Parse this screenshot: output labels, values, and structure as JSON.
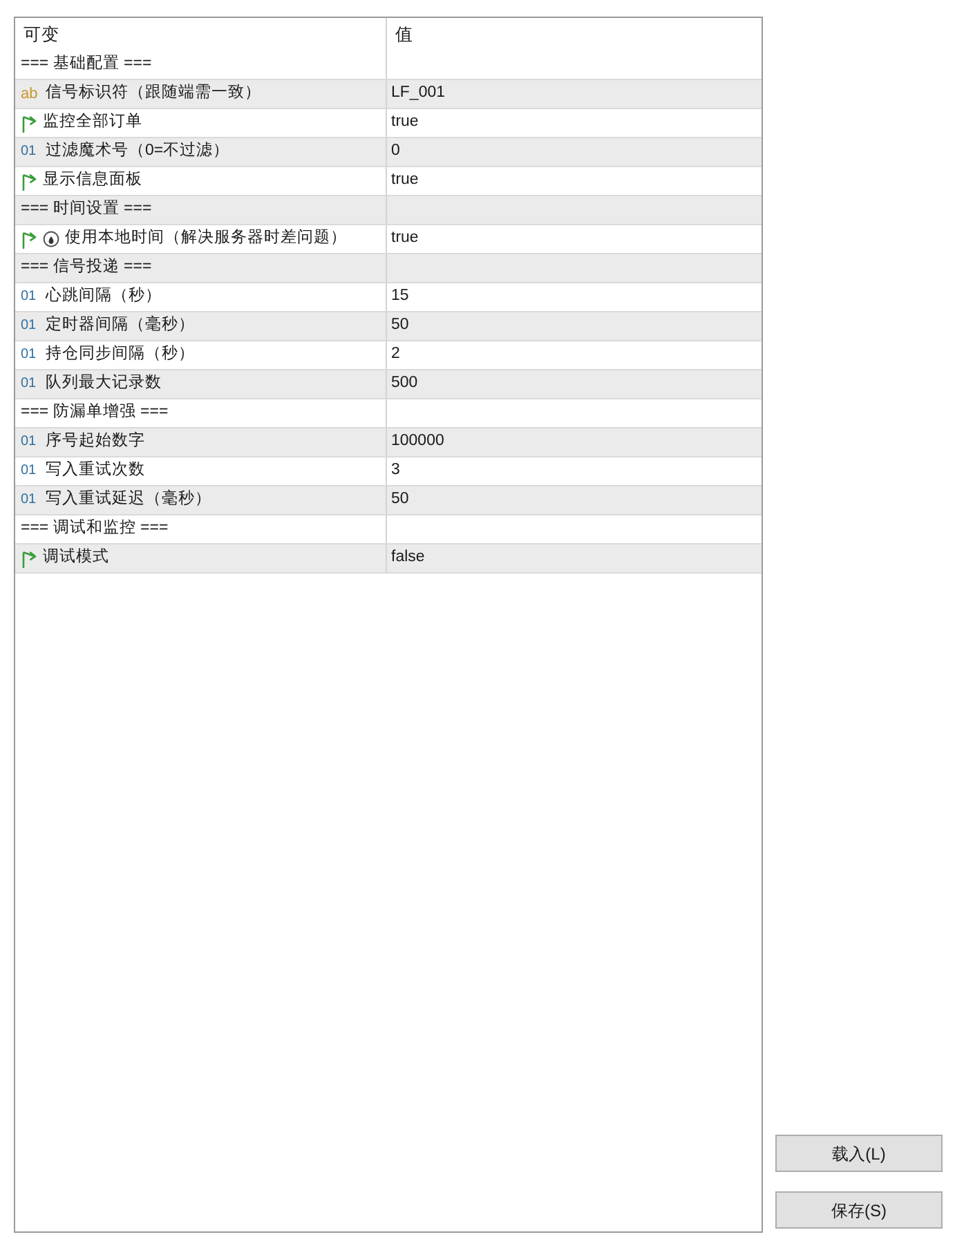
{
  "table": {
    "columns": [
      "可变",
      "值"
    ],
    "rows": [
      {
        "kind": "section",
        "name": "=== 基础配置 ==="
      },
      {
        "kind": "string",
        "type_icon": "ab",
        "name": "信号标识符（跟随端需一致）",
        "value": "LF_001"
      },
      {
        "kind": "bool",
        "name": "监控全部订单",
        "value": "true"
      },
      {
        "kind": "number",
        "type_icon": "01",
        "name": "过滤魔术号（0=不过滤）",
        "value": "0"
      },
      {
        "kind": "bool",
        "name": "显示信息面板",
        "value": "true"
      },
      {
        "kind": "section",
        "name": "=== 时间设置 ==="
      },
      {
        "kind": "bool",
        "emblem": true,
        "name": "使用本地时间（解决服务器时差问题）",
        "value": "true"
      },
      {
        "kind": "section",
        "name": "=== 信号投递 ==="
      },
      {
        "kind": "number",
        "type_icon": "01",
        "name": "心跳间隔（秒）",
        "value": "15"
      },
      {
        "kind": "number",
        "type_icon": "01",
        "name": "定时器间隔（毫秒）",
        "value": "50"
      },
      {
        "kind": "number",
        "type_icon": "01",
        "name": "持仓同步间隔（秒）",
        "value": "2"
      },
      {
        "kind": "number",
        "type_icon": "01",
        "name": "队列最大记录数",
        "value": "500"
      },
      {
        "kind": "section",
        "name": "=== 防漏单增强 ==="
      },
      {
        "kind": "number",
        "type_icon": "01",
        "name": "序号起始数字",
        "value": "100000"
      },
      {
        "kind": "number",
        "type_icon": "01",
        "name": "写入重试次数",
        "value": "3"
      },
      {
        "kind": "number",
        "type_icon": "01",
        "name": "写入重试延迟（毫秒）",
        "value": "50"
      },
      {
        "kind": "section",
        "name": "=== 调试和监控 ==="
      },
      {
        "kind": "bool",
        "name": "调试模式",
        "value": "false"
      }
    ]
  },
  "buttons": [
    "载入(L)",
    "保存(S)"
  ]
}
